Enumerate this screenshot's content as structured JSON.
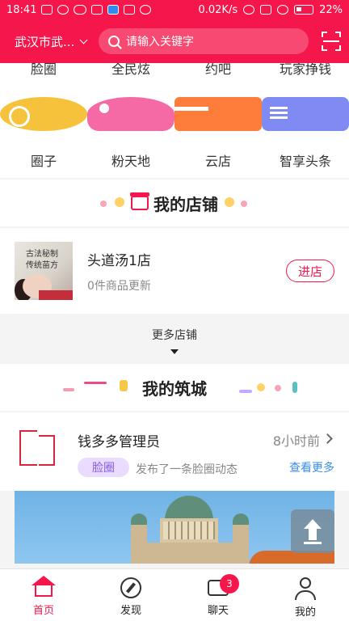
{
  "status_bar": {
    "time": "18:41",
    "speed": "0.02K/s",
    "battery": "22%"
  },
  "header": {
    "city": "武汉市武...",
    "search_placeholder": "请输入关键字"
  },
  "partial_row": [
    "脸圈",
    "全民炫",
    "约吧",
    "玩家挣钱"
  ],
  "grid_items": [
    {
      "label": "圈子",
      "icon": "chat-bubble-icon",
      "color": "#f7c23b"
    },
    {
      "label": "粉天地",
      "icon": "fans-icon",
      "color": "#f56aa4"
    },
    {
      "label": "云店",
      "icon": "store-icon",
      "color": "#ff7d3b"
    },
    {
      "label": "智享头条",
      "icon": "news-icon",
      "color": "#7f8bf3"
    }
  ],
  "my_store": {
    "title": "我的店铺",
    "store": {
      "thumb_line1": "古法秘制",
      "thumb_line2": "传统苗方",
      "name": "头道汤1店",
      "subtitle": "0件商品更新",
      "enter_label": "进店"
    },
    "more_label": "更多店铺"
  },
  "my_city": {
    "title": "我的筑城",
    "post": {
      "author": "钱多多管理员",
      "time": "8小时前",
      "tag": "脸圈",
      "text": "发布了一条脸圈动态",
      "see_more": "查看更多"
    }
  },
  "tabbar": {
    "items": [
      {
        "label": "首页",
        "active": true
      },
      {
        "label": "发现",
        "active": false
      },
      {
        "label": "聊天",
        "active": false,
        "badge": "3"
      },
      {
        "label": "我的",
        "active": false
      }
    ]
  },
  "colors": {
    "accent": "#f5174b",
    "link": "#3a8ee6",
    "tag_bg": "#e9dcff"
  }
}
